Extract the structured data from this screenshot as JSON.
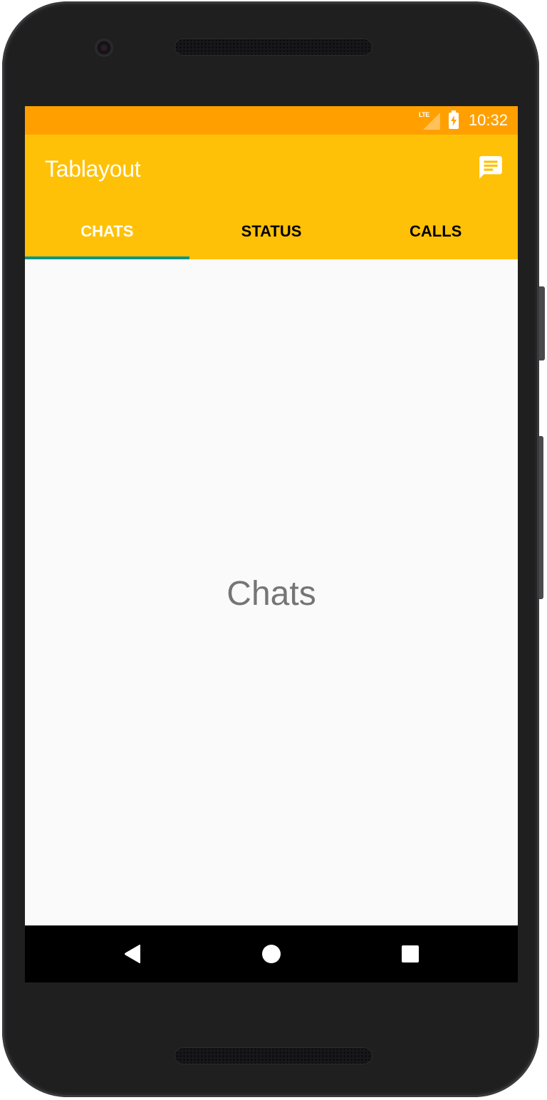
{
  "device": {
    "model": "Android phone frame"
  },
  "status_bar": {
    "network_label": "LTE",
    "time": "10:32",
    "background_color": "#ffa000"
  },
  "toolbar": {
    "title": "Tablayout",
    "action_icon": "chat-message-icon",
    "background_color": "#ffc107"
  },
  "tabs": {
    "items": [
      {
        "label": "CHATS",
        "active": true
      },
      {
        "label": "STATUS",
        "active": false
      },
      {
        "label": "CALLS",
        "active": false
      }
    ],
    "indicator_color": "#009688"
  },
  "content": {
    "text": "Chats"
  },
  "nav_bar": {
    "buttons": [
      {
        "name": "back",
        "icon": "back-triangle-icon"
      },
      {
        "name": "home",
        "icon": "home-circle-icon"
      },
      {
        "name": "recents",
        "icon": "recents-square-icon"
      }
    ]
  }
}
